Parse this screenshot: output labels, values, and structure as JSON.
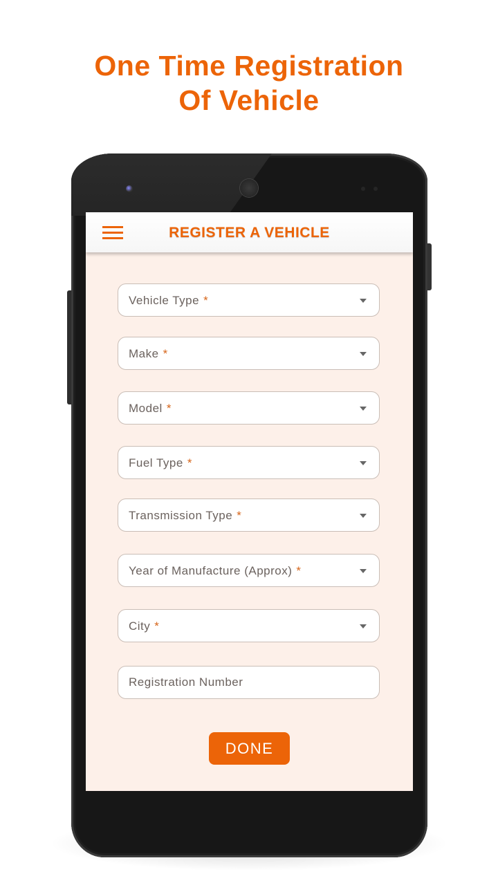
{
  "headline": {
    "line1": "One Time Registration",
    "line2": "Of Vehicle"
  },
  "colors": {
    "accent": "#ec6408",
    "screen_background": "#fdf0e9",
    "required_marker": "#d6651a"
  },
  "app": {
    "menu_icon": "hamburger-menu-icon",
    "title": "REGISTER A VEHICLE"
  },
  "form": {
    "required_marker": "*",
    "fields": [
      {
        "label": "Vehicle Type",
        "type": "dropdown",
        "required": true
      },
      {
        "label": "Make",
        "type": "dropdown",
        "required": true
      },
      {
        "label": "Model",
        "type": "dropdown",
        "required": true
      },
      {
        "label": "Fuel Type",
        "type": "dropdown",
        "required": true
      },
      {
        "label": "Transmission Type",
        "type": "dropdown",
        "required": true
      },
      {
        "label": "Year of Manufacture (Approx)",
        "type": "dropdown",
        "required": true
      },
      {
        "label": "City",
        "type": "dropdown",
        "required": true
      }
    ],
    "registration_number": {
      "placeholder": "Registration Number",
      "value": ""
    },
    "submit_label": "DONE"
  }
}
